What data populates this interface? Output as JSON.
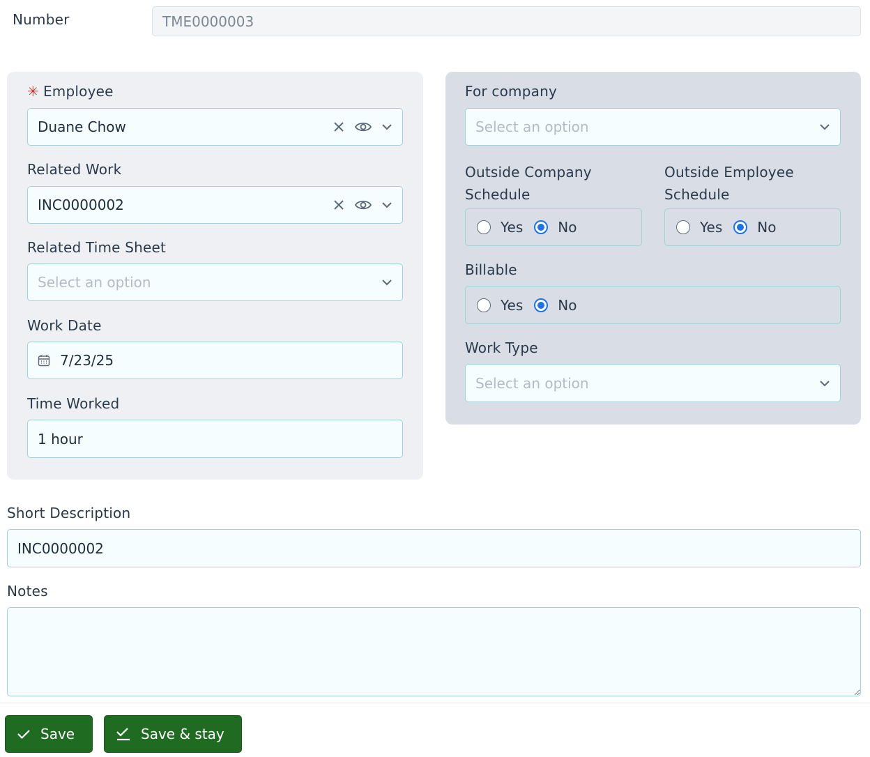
{
  "number": {
    "label": "Number",
    "value": "TME0000003"
  },
  "employee": {
    "required_mark": "✳",
    "label": "Employee",
    "value": "Duane Chow"
  },
  "related_work": {
    "label": "Related Work",
    "value": "INC0000002"
  },
  "related_time_sheet": {
    "label": "Related Time Sheet",
    "placeholder": "Select an option"
  },
  "work_date": {
    "label": "Work Date",
    "value": "7/23/25"
  },
  "time_worked": {
    "label": "Time Worked",
    "value": "1 hour"
  },
  "for_company": {
    "label": "For company",
    "placeholder": "Select an option"
  },
  "outside_company_schedule": {
    "label_line1": "Outside Company",
    "label_line2": "Schedule",
    "yes": "Yes",
    "no": "No",
    "selected": "No"
  },
  "outside_employee_schedule": {
    "label_line1": "Outside Employee",
    "label_line2": "Schedule",
    "yes": "Yes",
    "no": "No",
    "selected": "No"
  },
  "billable": {
    "label": "Billable",
    "yes": "Yes",
    "no": "No",
    "selected": "No"
  },
  "work_type": {
    "label": "Work Type",
    "placeholder": "Select an option"
  },
  "short_description": {
    "label": "Short Description",
    "value": "INC0000002"
  },
  "notes": {
    "label": "Notes",
    "value": ""
  },
  "buttons": {
    "save": "Save",
    "save_stay": "Save & stay"
  },
  "colors": {
    "primary_button": "#1f6b21",
    "field_border": "#9fd3d9",
    "radio_checked": "#1a73e8",
    "required": "#c0392b"
  }
}
